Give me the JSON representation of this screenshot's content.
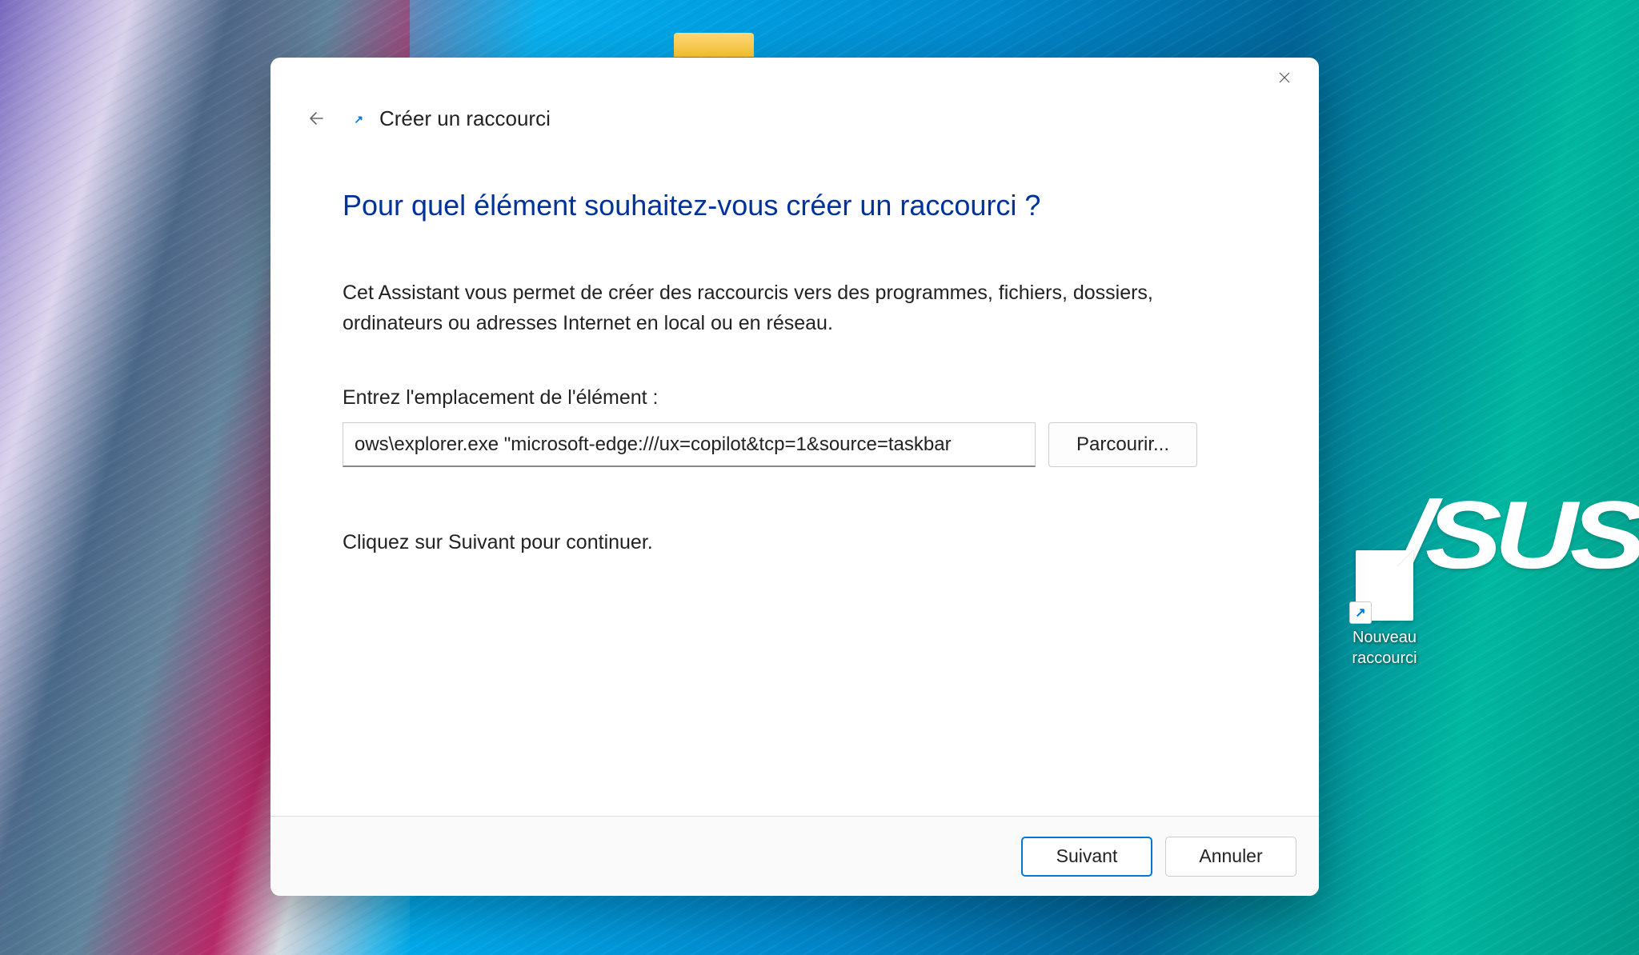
{
  "dialog": {
    "title": "Créer un raccourci",
    "heading": "Pour quel élément souhaitez-vous créer un raccourci ?",
    "description": "Cet Assistant vous permet de créer des raccourcis vers des programmes, fichiers, dossiers, ordinateurs ou adresses Internet en local ou en réseau.",
    "input_label": "Entrez l'emplacement de l'élément :",
    "input_value": "ows\\explorer.exe \"microsoft-edge:///ux=copilot&tcp=1&source=taskbar",
    "browse_button": "Parcourir...",
    "continue_hint": "Cliquez sur Suivant pour continuer.",
    "next_button": "Suivant",
    "cancel_button": "Annuler"
  },
  "desktop": {
    "shortcut_label": "Nouveau raccourci",
    "brand_logo": "/SUS"
  }
}
